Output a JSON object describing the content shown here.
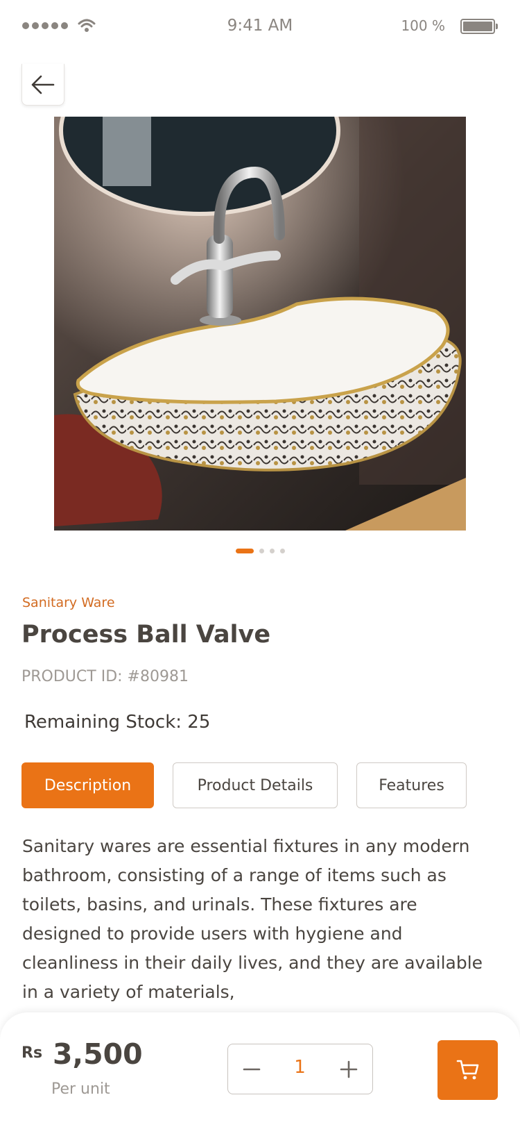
{
  "status_bar": {
    "time": "9:41 AM",
    "battery": "100 %",
    "icons": [
      "signal-dots-icon",
      "wifi-icon",
      "battery-icon"
    ]
  },
  "nav": {
    "back_icon": "arrow-left-icon"
  },
  "gallery": {
    "image": "sink-photo",
    "page_count": 4,
    "active_index": 0
  },
  "product": {
    "category": "Sanitary Ware",
    "name": "Process Ball Valve",
    "id": "PRODUCT ID: #80981",
    "stock": "Remaining Stock: 25"
  },
  "tabs": [
    {
      "label": "Description",
      "active": true
    },
    {
      "label": "Product Details",
      "active": false
    },
    {
      "label": "Features",
      "active": false
    }
  ],
  "description": "Sanitary wares are essential fixtures in any modern bathroom, consisting of a range of items such as toilets, basins, and urinals. These fixtures are designed to provide users with hygiene and cleanliness in their daily lives, and they are available in a variety of materials,",
  "footer": {
    "currency": "Rs",
    "price": "3,500",
    "per_unit": "Per unit",
    "quantity": "1",
    "cart_icon": "cart-icon"
  },
  "colors": {
    "accent": "#ea7316",
    "text": "#4a4540",
    "muted": "#9e9994"
  }
}
